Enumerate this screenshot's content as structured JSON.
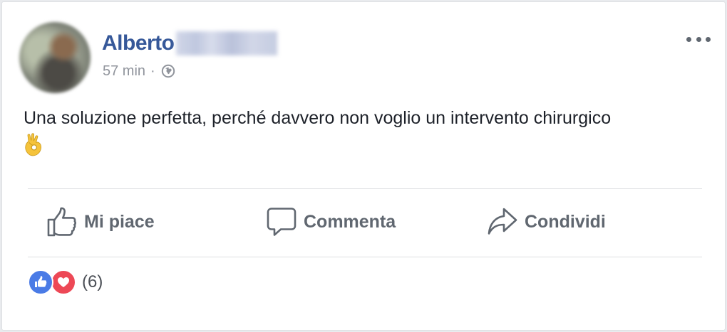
{
  "post": {
    "author": {
      "first_name": "Alberto",
      "surname_redacted": true
    },
    "timestamp": "57 min",
    "separator": "·",
    "privacy_icon": "globe-icon",
    "text": "Una soluzione perfetta, perché davvero non voglio un intervento chirurgico",
    "emoji": "ok-hand-emoji"
  },
  "actions": {
    "like_label": "Mi piace",
    "comment_label": "Commenta",
    "share_label": "Condividi"
  },
  "reactions": {
    "types": [
      "like",
      "love"
    ],
    "count_text": "(6)"
  },
  "colors": {
    "author_link": "#365899",
    "meta_text": "#90949c",
    "action_text": "#606770",
    "like_reaction": "#4a7be6",
    "love_reaction": "#ed4856"
  }
}
